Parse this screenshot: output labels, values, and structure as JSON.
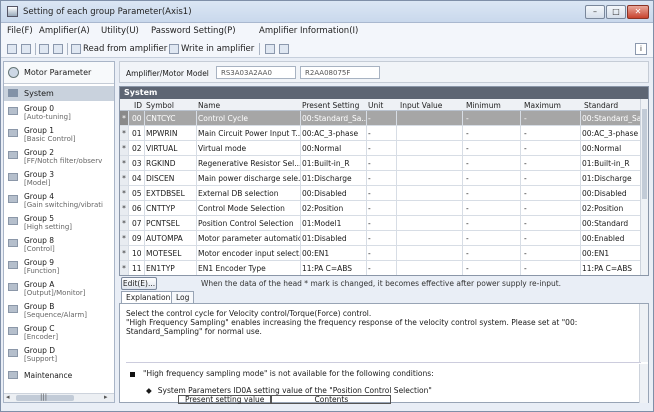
{
  "window": {
    "title": "Setting of each group Parameter(Axis1)"
  },
  "menu": [
    "File(F)",
    "Amplifier(A)",
    "Utility(U)",
    "Password Setting(P)",
    "Amplifier Information(I)"
  ],
  "toolbar": {
    "read_label": "Read from amplifier",
    "write_label": "Write in amplifier"
  },
  "sidebar": {
    "motor_param": "Motor Parameter",
    "system": "System",
    "groups": [
      {
        "label": "Group 0",
        "sub": "[Auto-tuning]"
      },
      {
        "label": "Group 1",
        "sub": "[Basic Control]"
      },
      {
        "label": "Group 2",
        "sub": "[FF/Notch filter/observ"
      },
      {
        "label": "Group 3",
        "sub": "[Model]"
      },
      {
        "label": "Group 4",
        "sub": "[Gain switching/vibrati"
      },
      {
        "label": "Group 5",
        "sub": "[High setting]"
      },
      {
        "label": "Group 8",
        "sub": "[Control]"
      },
      {
        "label": "Group 9",
        "sub": "[Function]"
      },
      {
        "label": "Group A",
        "sub": "[Output]/Monitor]"
      },
      {
        "label": "Group B",
        "sub": "[Sequence/Alarm]"
      },
      {
        "label": "Group C",
        "sub": "[Encoder]"
      },
      {
        "label": "Group D",
        "sub": "[Support]"
      }
    ],
    "maintenance": "Maintenance",
    "hscroll_dots": "|||"
  },
  "amp": {
    "label": "Amplifier/Motor Model",
    "model": "RS3A03A2AA0",
    "motor": "R2AA08075F"
  },
  "grid": {
    "title": "System",
    "headers": [
      "ID",
      "Symbol",
      "Name",
      "Present Setting",
      "Unit",
      "Input Value",
      "Minimum",
      "Maximum",
      "Standard"
    ],
    "rows": [
      {
        "star": "*",
        "id": "00",
        "sym": "CNTCYC",
        "name": "Control Cycle",
        "present": "00:Standard_Sa...",
        "unit": "-",
        "input": "",
        "min": "-",
        "max": "-",
        "std": "00:Standard_Sa..."
      },
      {
        "star": "*",
        "id": "01",
        "sym": "MPWRIN",
        "name": "Main Circuit Power Input T...",
        "present": "00:AC_3-phase",
        "unit": "-",
        "input": "",
        "min": "-",
        "max": "-",
        "std": "00:AC_3-phase"
      },
      {
        "star": "*",
        "id": "02",
        "sym": "VIRTUAL",
        "name": "Virtual mode",
        "present": "00:Normal",
        "unit": "-",
        "input": "",
        "min": "-",
        "max": "-",
        "std": "00:Normal"
      },
      {
        "star": "*",
        "id": "03",
        "sym": "RGKIND",
        "name": "Regenerative Resistor Sel...",
        "present": "01:Built-in_R",
        "unit": "-",
        "input": "",
        "min": "-",
        "max": "-",
        "std": "01:Built-in_R"
      },
      {
        "star": "*",
        "id": "04",
        "sym": "DISCEN",
        "name": "Main power discharge sele...",
        "present": "01:Discharge",
        "unit": "-",
        "input": "",
        "min": "-",
        "max": "-",
        "std": "01:Discharge"
      },
      {
        "star": "*",
        "id": "05",
        "sym": "EXTDBSEL",
        "name": "External DB selection",
        "present": "00:Disabled",
        "unit": "-",
        "input": "",
        "min": "-",
        "max": "-",
        "std": "00:Disabled"
      },
      {
        "star": "*",
        "id": "06",
        "sym": "CNTTYP",
        "name": "Control Mode Selection",
        "present": "02:Position",
        "unit": "-",
        "input": "",
        "min": "-",
        "max": "-",
        "std": "02:Position"
      },
      {
        "star": "*",
        "id": "07",
        "sym": "PCNTSEL",
        "name": "Position Control Selection",
        "present": "01:Model1",
        "unit": "-",
        "input": "",
        "min": "-",
        "max": "-",
        "std": "00:Standard"
      },
      {
        "star": "*",
        "id": "09",
        "sym": "AUTOMPA",
        "name": "Motor parameter automatic...",
        "present": "01:Disabled",
        "unit": "-",
        "input": "",
        "min": "-",
        "max": "-",
        "std": "00:Enabled"
      },
      {
        "star": "*",
        "id": "10",
        "sym": "MOTESEL",
        "name": "Motor encoder input select...",
        "present": "00:EN1",
        "unit": "-",
        "input": "",
        "min": "-",
        "max": "-",
        "std": "00:EN1"
      },
      {
        "star": "*",
        "id": "11",
        "sym": "EN1TYP",
        "name": "EN1 Encoder Type",
        "present": "11:PA C=ABS",
        "unit": "-",
        "input": "",
        "min": "-",
        "max": "-",
        "std": "11:PA C=ABS"
      }
    ]
  },
  "edit": {
    "label": "Edit(E)...",
    "note": "When the data of the head * mark is changed, it becomes effective after power supply re-input."
  },
  "tabs": [
    "Explanation",
    "Log"
  ],
  "explanation": {
    "text": "Select the control cycle for Velocity control/Torque(Force) control.\n\"High Frequency Sampling\" enables increasing the frequency response of the velocity control system. Please set at \"00: Standard_Sampling\" for normal use.",
    "bullet1": "\"High frequency sampling mode\" is not available for the following conditions:",
    "bullet2": "System Parameters ID0A setting value of the \"Position Control Selection\"",
    "col1": "Present setting value",
    "col2": "Contents"
  }
}
